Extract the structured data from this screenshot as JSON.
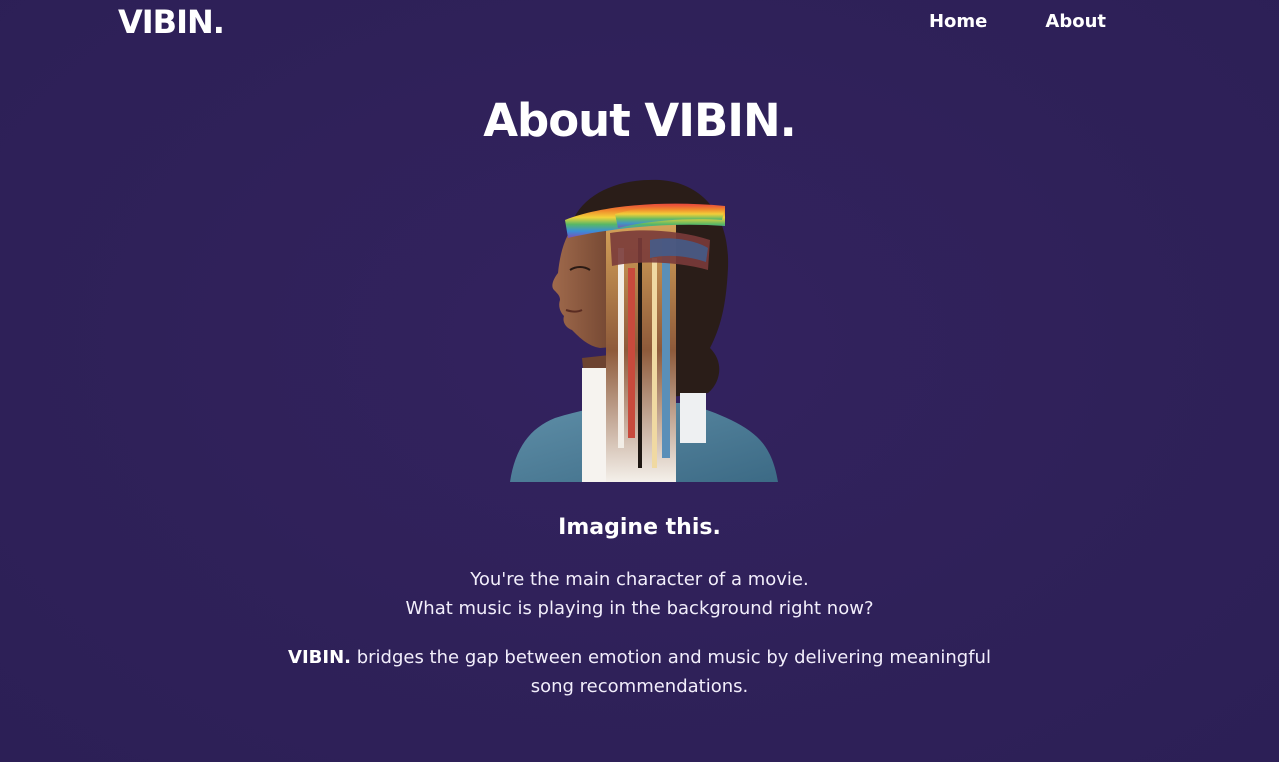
{
  "header": {
    "logo": "VIBIN.",
    "nav": [
      {
        "label": "Home"
      },
      {
        "label": "About"
      }
    ]
  },
  "main": {
    "title": "About VIBIN.",
    "subheading": "Imagine this.",
    "intro_line_1": "You're the main character of a movie.",
    "intro_line_2": "What music is playing in the background right now?",
    "brand": "VIBIN.",
    "description": " bridges the gap between emotion and music by delivering meaningful song recommendations."
  },
  "colors": {
    "background": "#2f2159",
    "text": "#ffffff"
  }
}
